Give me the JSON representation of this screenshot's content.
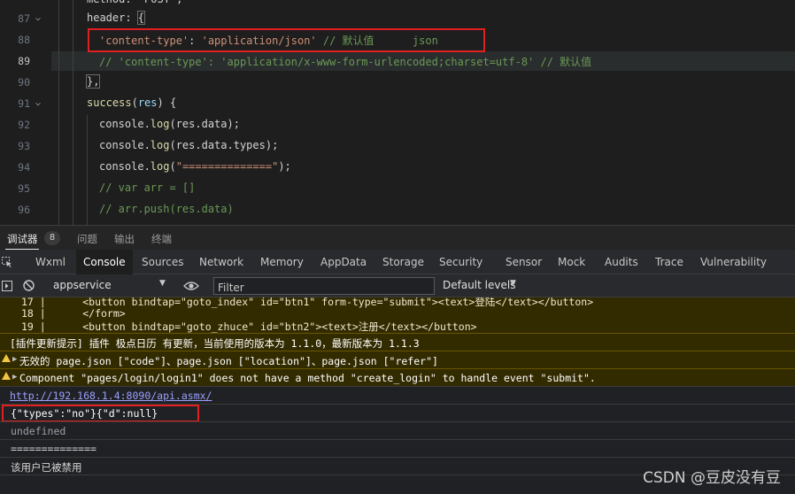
{
  "editor": {
    "lines": [
      {
        "num": "87",
        "text": "header: {"
      },
      {
        "num": "88",
        "text": "'content-type': 'application/json' // 默认值      json"
      },
      {
        "num": "89",
        "text": "// 'content-type': 'application/x-www-form-urlencoded;charset=utf-8' // 默认值"
      },
      {
        "num": "90",
        "text": "},"
      },
      {
        "num": "91",
        "text": "success(res) {"
      },
      {
        "num": "92",
        "text": "console.log(res.data);"
      },
      {
        "num": "93",
        "text": "console.log(res.data.types);"
      },
      {
        "num": "94",
        "text": "console.log(\"==============\");"
      },
      {
        "num": "95",
        "text": "// var arr = []"
      },
      {
        "num": "96",
        "text": "// arr.push(res.data)"
      }
    ],
    "line88": {
      "key": "'content-type'",
      "colon": ": ",
      "value": "'application/json'",
      "comment": " // 默认值      json"
    },
    "line89": {
      "comment": "// 'content-type': 'application/x-www-form-urlencoded;charset=utf-8' // 默认值"
    },
    "line91": {
      "fn": "success",
      "open": "(",
      "arg": "res",
      "close": ") {"
    },
    "line92": {
      "obj": "console.",
      "fn": "log",
      "args": "(res.data);"
    },
    "line93": {
      "obj": "console.",
      "fn": "log",
      "args": "(res.data.types);"
    },
    "line94": {
      "obj": "console.",
      "fn": "log",
      "open": "(",
      "str": "\"==============\"",
      "close": ");"
    },
    "line87": {
      "key": "header: ",
      "brace": "{"
    },
    "line90": {
      "brace": "},"
    },
    "line95": {
      "comment": "// var arr = []"
    },
    "line96": {
      "comment": "// arr.push(res.data)"
    }
  },
  "panel_tabs": {
    "debugger": "调试器",
    "debugger_count": "8",
    "issues": "问题",
    "output": "输出",
    "terminal": "终端"
  },
  "dev_tabs": [
    "Wxml",
    "Console",
    "Sources",
    "Network",
    "Memory",
    "AppData",
    "Storage",
    "Security",
    "Sensor",
    "Mock",
    "Audits",
    "Trace",
    "Vulnerability"
  ],
  "toolbar": {
    "context": "appservice",
    "filter_placeholder": "Filter",
    "levels": "Default levels"
  },
  "console": {
    "snippet": [
      "17 |      <button bindtap=\"goto_index\" id=\"btn1\" form-type=\"submit\"><text>登陆</text></button>",
      "18 |      </form>",
      "19 |      <button bindtap=\"goto_zhuce\" id=\"btn2\"><text>注册</text></button>"
    ],
    "plugin_warning": "[插件更新提示] 插件 极点日历 有更新，当前使用的版本为 1.1.0，最新版本为 1.1.3",
    "invalid_warning": "无效的 page.json [\"code\"]、page.json [\"location\"]、page.json [\"refer\"]",
    "component_warning": "Component \"pages/login/login1\" does not have a method \"create_login\" to handle event \"submit\".",
    "url": "http://192.168.1.4:8090/api.asmx/",
    "response": "{\"types\":\"no\"}{\"d\":null}",
    "undefined": "undefined",
    "separator": "==============",
    "disabled_msg": "该用户已被禁用"
  },
  "watermark": "CSDN @豆皮没有豆",
  "colors": {
    "highlight_box": "#e02020",
    "string": "#ce9178",
    "comment": "#6a9955",
    "function": "#dcdcaa",
    "warning_bg": "#332b00"
  }
}
